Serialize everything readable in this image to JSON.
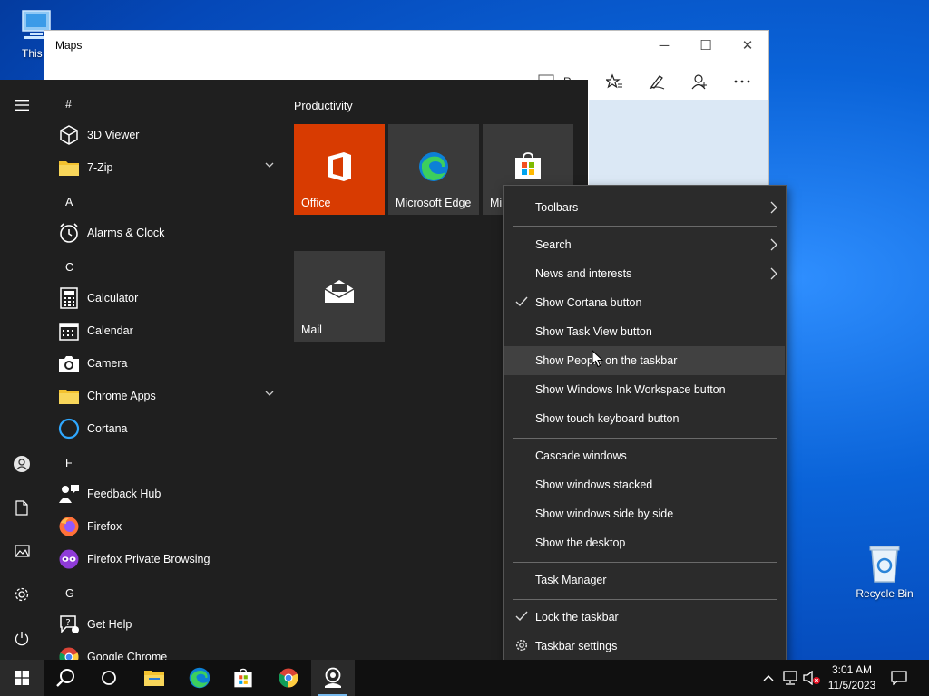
{
  "desktop": {
    "icons": [
      {
        "label": "This P"
      },
      {
        "label": "Recycle Bin"
      }
    ]
  },
  "maps_window": {
    "title": "Maps",
    "controls": {
      "minimize": "─",
      "maximize": "☐",
      "close": "✕"
    },
    "toolbar_partial_text": "R"
  },
  "start_menu": {
    "apps": [
      {
        "type": "header",
        "label": "#"
      },
      {
        "type": "app",
        "label": "3D Viewer",
        "icon": "cube-icon"
      },
      {
        "type": "app",
        "label": "7-Zip",
        "icon": "folder-icon",
        "expandable": true
      },
      {
        "type": "header",
        "label": "A"
      },
      {
        "type": "app",
        "label": "Alarms & Clock",
        "icon": "alarm-clock-icon"
      },
      {
        "type": "header",
        "label": "C"
      },
      {
        "type": "app",
        "label": "Calculator",
        "icon": "calculator-icon"
      },
      {
        "type": "app",
        "label": "Calendar",
        "icon": "calendar-icon"
      },
      {
        "type": "app",
        "label": "Camera",
        "icon": "camera-icon"
      },
      {
        "type": "app",
        "label": "Chrome Apps",
        "icon": "folder-icon",
        "expandable": true
      },
      {
        "type": "app",
        "label": "Cortana",
        "icon": "cortana-icon"
      },
      {
        "type": "header",
        "label": "F"
      },
      {
        "type": "app",
        "label": "Feedback Hub",
        "icon": "feedback-icon"
      },
      {
        "type": "app",
        "label": "Firefox",
        "icon": "firefox-icon"
      },
      {
        "type": "app",
        "label": "Firefox Private Browsing",
        "icon": "firefox-private-icon"
      },
      {
        "type": "header",
        "label": "G"
      },
      {
        "type": "app",
        "label": "Get Help",
        "icon": "help-icon"
      },
      {
        "type": "app",
        "label": "Google Chrome",
        "icon": "chrome-icon"
      }
    ],
    "tile_group": "Productivity",
    "tiles": [
      {
        "label": "Office",
        "color": "#d83b01"
      },
      {
        "label": "Microsoft Edge",
        "color": "#3a3a3a"
      },
      {
        "label": "Mi",
        "color": "#3a3a3a"
      },
      {
        "label": "Mail",
        "color": "#3a3a3a"
      }
    ]
  },
  "context_menu": {
    "items": [
      {
        "label": "Toolbars",
        "submenu": true
      },
      {
        "label": "Search",
        "submenu": true
      },
      {
        "label": "News and interests",
        "submenu": true
      },
      {
        "label": "Show Cortana button",
        "checked": true
      },
      {
        "label": "Show Task View button"
      },
      {
        "label": "Show People on the taskbar",
        "hover": true
      },
      {
        "label": "Show Windows Ink Workspace button"
      },
      {
        "label": "Show touch keyboard button"
      },
      {
        "label": "Cascade windows"
      },
      {
        "label": "Show windows stacked"
      },
      {
        "label": "Show windows side by side"
      },
      {
        "label": "Show the desktop"
      },
      {
        "label": "Task Manager"
      },
      {
        "label": "Lock the taskbar",
        "checked": true
      },
      {
        "label": "Taskbar settings",
        "icon": "gear-icon"
      }
    ]
  },
  "taskbar": {
    "clock_time": "3:01 AM",
    "clock_date": "11/5/2023"
  },
  "colors": {
    "accent": "#0078d7",
    "office_tile": "#d83b01",
    "menu_bg": "#2b2b2b",
    "start_bg": "#1f1f1f"
  }
}
